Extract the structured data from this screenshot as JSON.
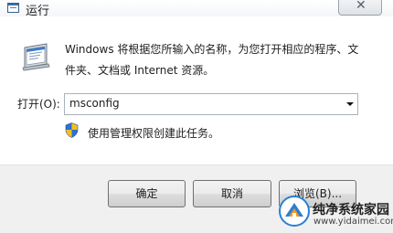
{
  "window": {
    "title": "运行",
    "close_glyph": "✕",
    "icon": "run-window-icon"
  },
  "content": {
    "app_icon": "run-program-icon",
    "description": "Windows 将根据您所输入的名称，为您打开相应的程序、文件夹、文档或 Internet 资源。",
    "open_label": "打开(O):",
    "open_value": "msconfig",
    "admin_icon": "uac-shield-icon",
    "admin_note": "使用管理权限创建此任务。"
  },
  "buttons": {
    "ok": "确定",
    "cancel": "取消",
    "browse": "浏览(B)..."
  },
  "watermark": {
    "name": "纯净系统家园",
    "url": "www.yidaimei.com",
    "logo_icon": "site-logo-icon"
  },
  "colors": {
    "footer_bg": "#f0f0f0",
    "field_border": "#a9b2bd",
    "shield_blue": "#2f6fd0",
    "shield_yellow": "#f2c01e",
    "logo_blue": "#2a7fd4",
    "logo_orange": "#f39a1e"
  }
}
